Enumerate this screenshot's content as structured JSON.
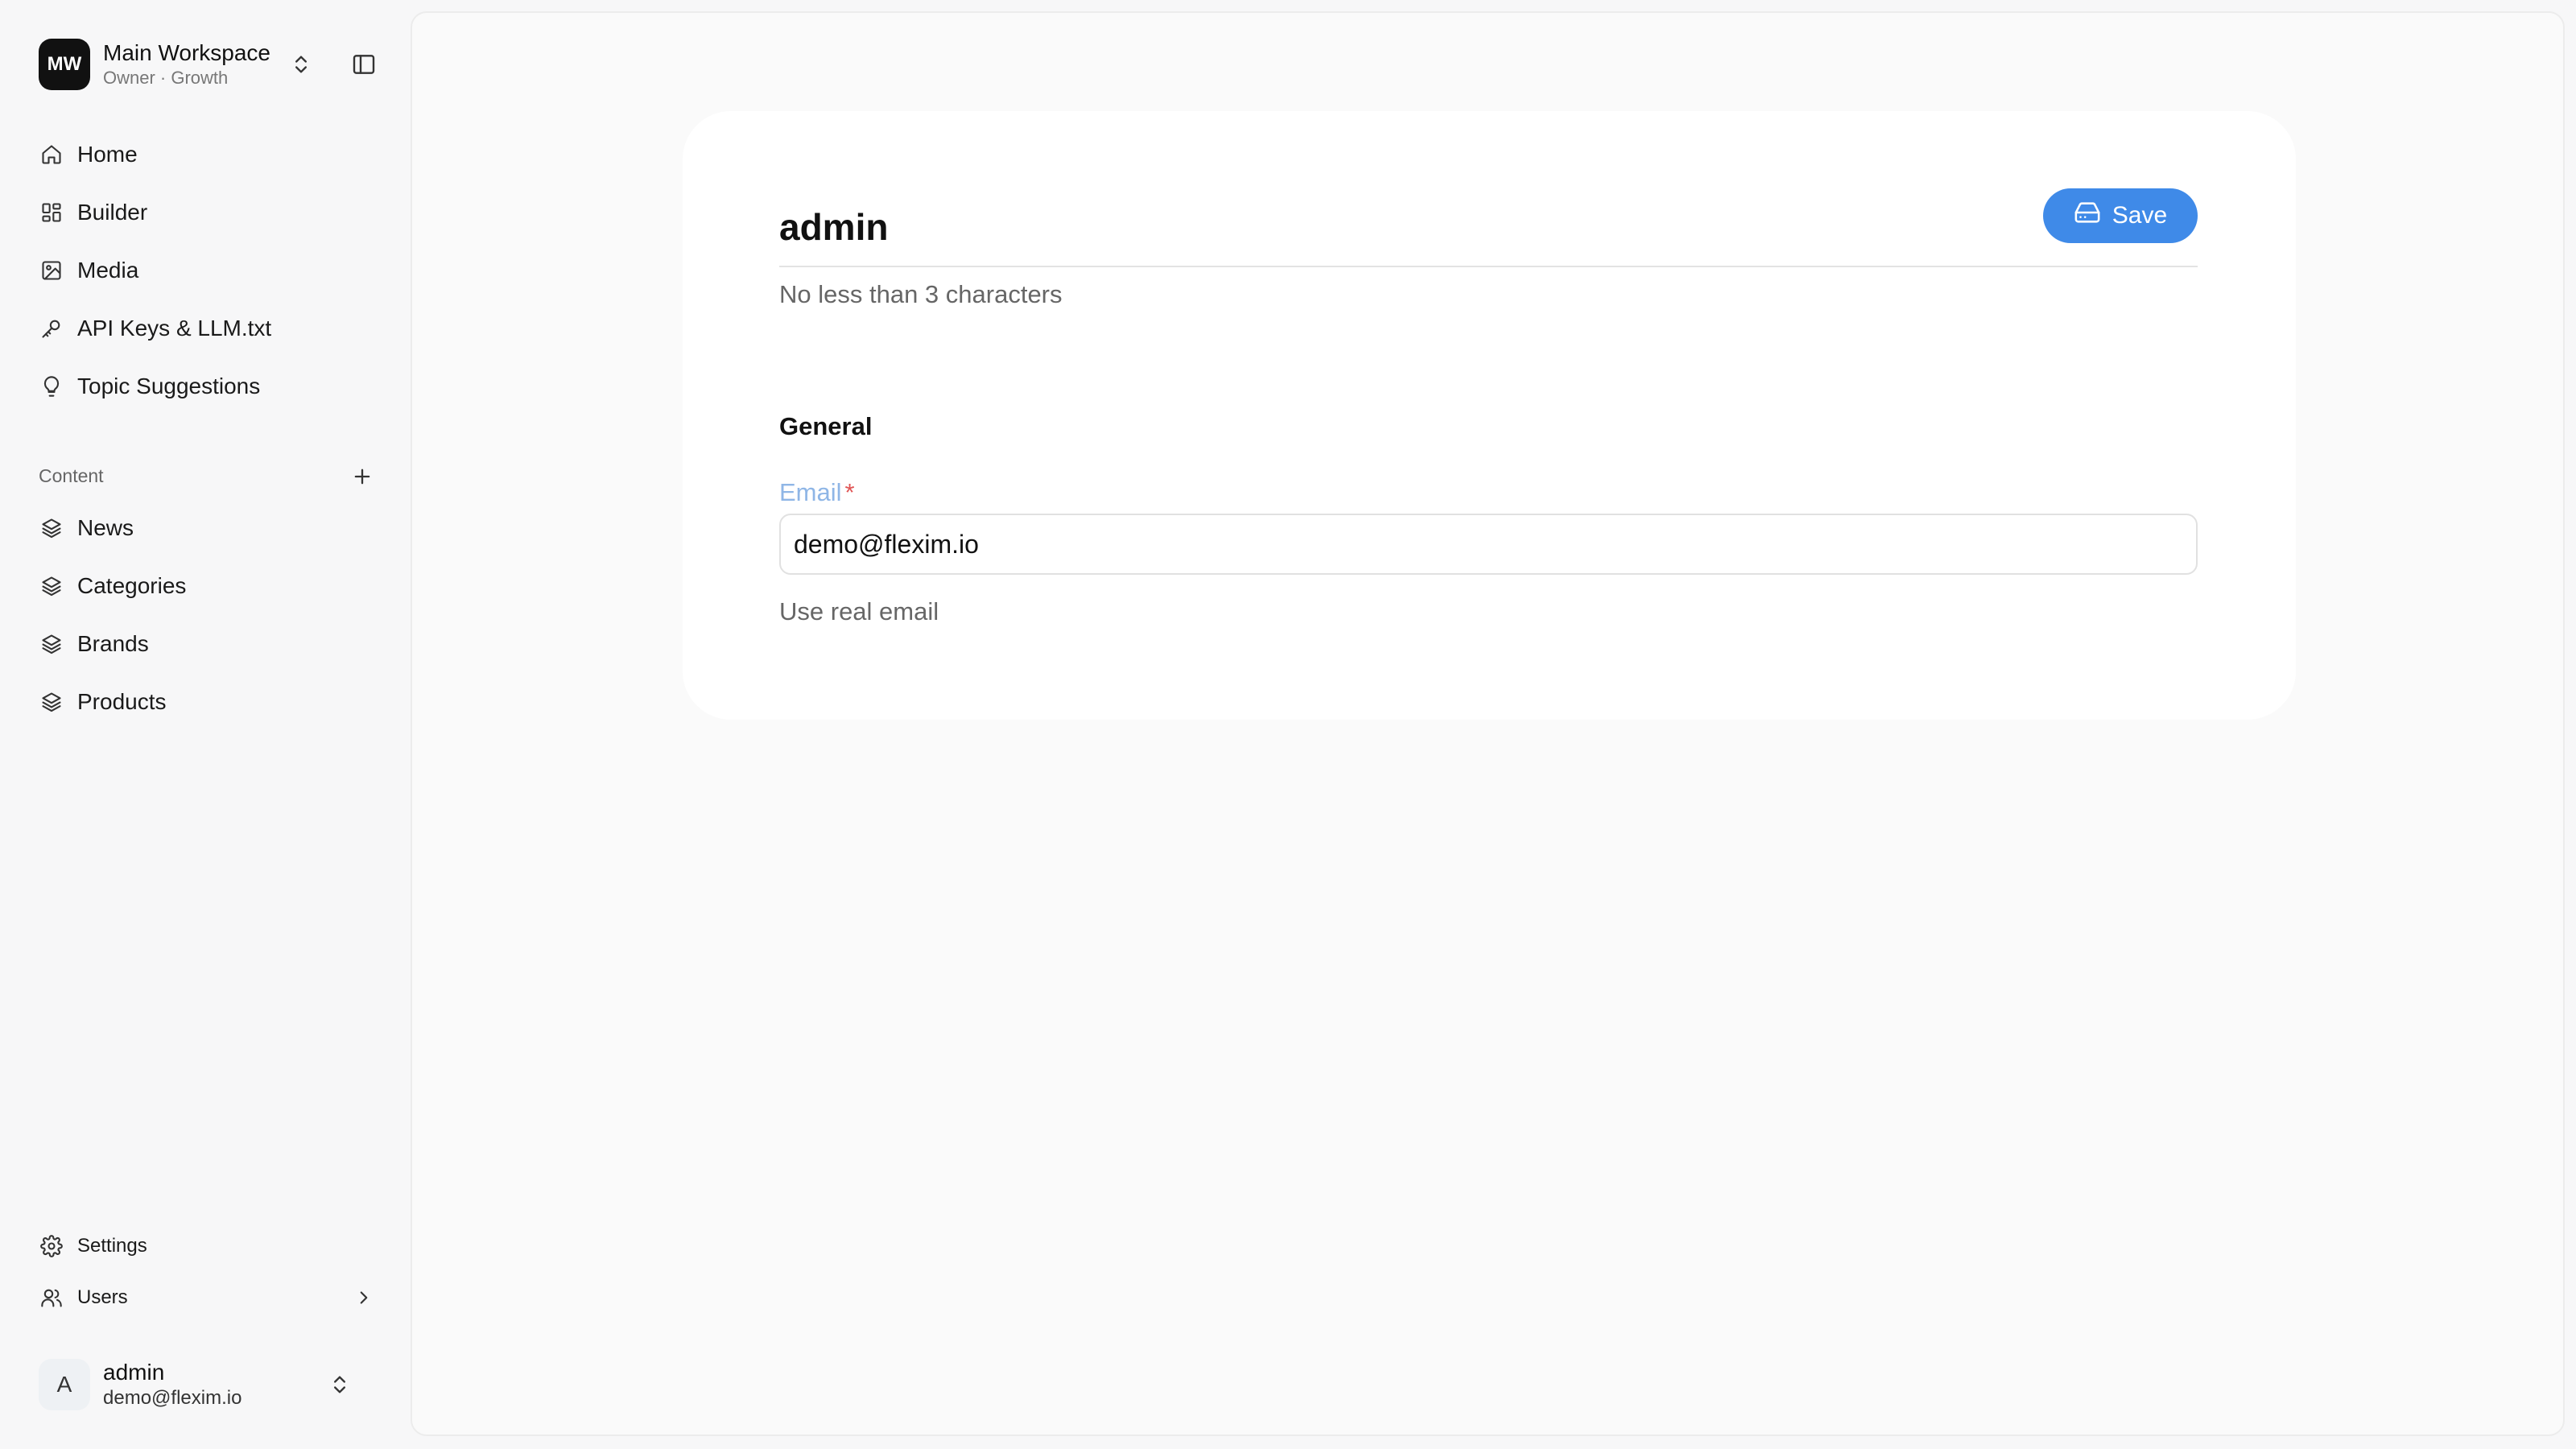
{
  "workspace": {
    "initials": "MW",
    "name": "Main Workspace",
    "subtitle": "Owner · Growth"
  },
  "nav": {
    "main": [
      {
        "label": "Home",
        "icon": "home-icon"
      },
      {
        "label": "Builder",
        "icon": "grid-icon"
      },
      {
        "label": "Media",
        "icon": "image-icon"
      },
      {
        "label": "API Keys & LLM.txt",
        "icon": "key-icon"
      },
      {
        "label": "Topic Suggestions",
        "icon": "lightbulb-icon"
      }
    ],
    "content_label": "Content",
    "content": [
      {
        "label": "News",
        "icon": "layers-icon"
      },
      {
        "label": "Categories",
        "icon": "layers-icon"
      },
      {
        "label": "Brands",
        "icon": "layers-icon"
      },
      {
        "label": "Products",
        "icon": "layers-icon"
      }
    ],
    "bottom": [
      {
        "label": "Settings",
        "icon": "gear-icon"
      },
      {
        "label": "Users",
        "icon": "users-icon"
      }
    ]
  },
  "user": {
    "initial": "A",
    "name": "admin",
    "email": "demo@flexim.io"
  },
  "form": {
    "name_value": "admin",
    "name_hint": "No less than 3 characters",
    "save_label": "Save",
    "section_title": "General",
    "email_label": "Email",
    "required_mark": "*",
    "email_value": "demo@flexim.io",
    "email_hint": "Use real email"
  },
  "colors": {
    "accent": "#3f8ae8",
    "label_blue": "#8fb6e6",
    "required_red": "#e05555"
  }
}
